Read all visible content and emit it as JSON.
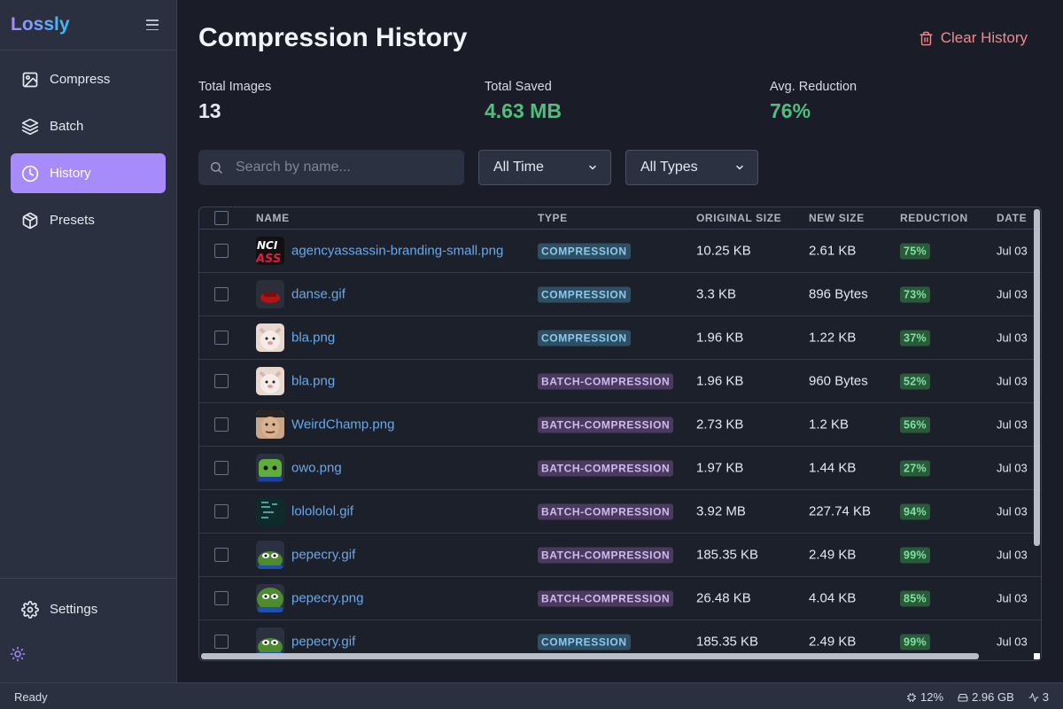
{
  "app": {
    "name": "Lossly"
  },
  "sidebar": {
    "items": [
      {
        "label": "Compress",
        "icon": "image-icon"
      },
      {
        "label": "Batch",
        "icon": "layers-icon"
      },
      {
        "label": "History",
        "icon": "clock-icon",
        "active": true
      },
      {
        "label": "Presets",
        "icon": "package-icon"
      }
    ],
    "settings_label": "Settings"
  },
  "page": {
    "title": "Compression History",
    "clear_label": "Clear History"
  },
  "stats": {
    "total_images_label": "Total Images",
    "total_images_value": "13",
    "total_saved_label": "Total Saved",
    "total_saved_value": "4.63 MB",
    "avg_reduction_label": "Avg. Reduction",
    "avg_reduction_value": "76%"
  },
  "filters": {
    "search_placeholder": "Search by name...",
    "time_value": "All Time",
    "type_value": "All Types"
  },
  "table": {
    "headers": {
      "name": "NAME",
      "type": "TYPE",
      "original": "ORIGINAL SIZE",
      "new": "NEW SIZE",
      "reduction": "REDUCTION",
      "date": "DATE"
    },
    "rows": [
      {
        "name": "agencyassassin-branding-small.png",
        "type": "COMPRESSION",
        "original": "10.25 KB",
        "new": "2.61 KB",
        "reduction": "75%",
        "date": "Jul 03",
        "thumb": "brand"
      },
      {
        "name": "danse.gif",
        "type": "COMPRESSION",
        "original": "3.3 KB",
        "new": "896 Bytes",
        "reduction": "73%",
        "date": "Jul 03",
        "thumb": "danse"
      },
      {
        "name": "bla.png",
        "type": "COMPRESSION",
        "original": "1.96 KB",
        "new": "1.22 KB",
        "reduction": "37%",
        "date": "Jul 03",
        "thumb": "cat"
      },
      {
        "name": "bla.png",
        "type": "BATCH-COMPRESSION",
        "original": "1.96 KB",
        "new": "960 Bytes",
        "reduction": "52%",
        "date": "Jul 03",
        "thumb": "cat"
      },
      {
        "name": "WeirdChamp.png",
        "type": "BATCH-COMPRESSION",
        "original": "2.73 KB",
        "new": "1.2 KB",
        "reduction": "56%",
        "date": "Jul 03",
        "thumb": "face"
      },
      {
        "name": "owo.png",
        "type": "BATCH-COMPRESSION",
        "original": "1.97 KB",
        "new": "1.44 KB",
        "reduction": "27%",
        "date": "Jul 03",
        "thumb": "owo"
      },
      {
        "name": "lolololol.gif",
        "type": "BATCH-COMPRESSION",
        "original": "3.92 MB",
        "new": "227.74 KB",
        "reduction": "94%",
        "date": "Jul 03",
        "thumb": "lol"
      },
      {
        "name": "pepecry.gif",
        "type": "BATCH-COMPRESSION",
        "original": "185.35 KB",
        "new": "2.49 KB",
        "reduction": "99%",
        "date": "Jul 03",
        "thumb": "pepe"
      },
      {
        "name": "pepecry.png",
        "type": "BATCH-COMPRESSION",
        "original": "26.48 KB",
        "new": "4.04 KB",
        "reduction": "85%",
        "date": "Jul 03",
        "thumb": "pepe2"
      },
      {
        "name": "pepecry.gif",
        "type": "COMPRESSION",
        "original": "185.35 KB",
        "new": "2.49 KB",
        "reduction": "99%",
        "date": "Jul 03",
        "thumb": "pepe"
      }
    ]
  },
  "status": {
    "text": "Ready",
    "cpu": "12%",
    "memory": "2.96 GB",
    "activity": "3"
  },
  "colors": {
    "accent": "#a78bfa",
    "green": "#4fbf7e",
    "danger": "#f08a8a",
    "link": "#6aa8e8"
  }
}
